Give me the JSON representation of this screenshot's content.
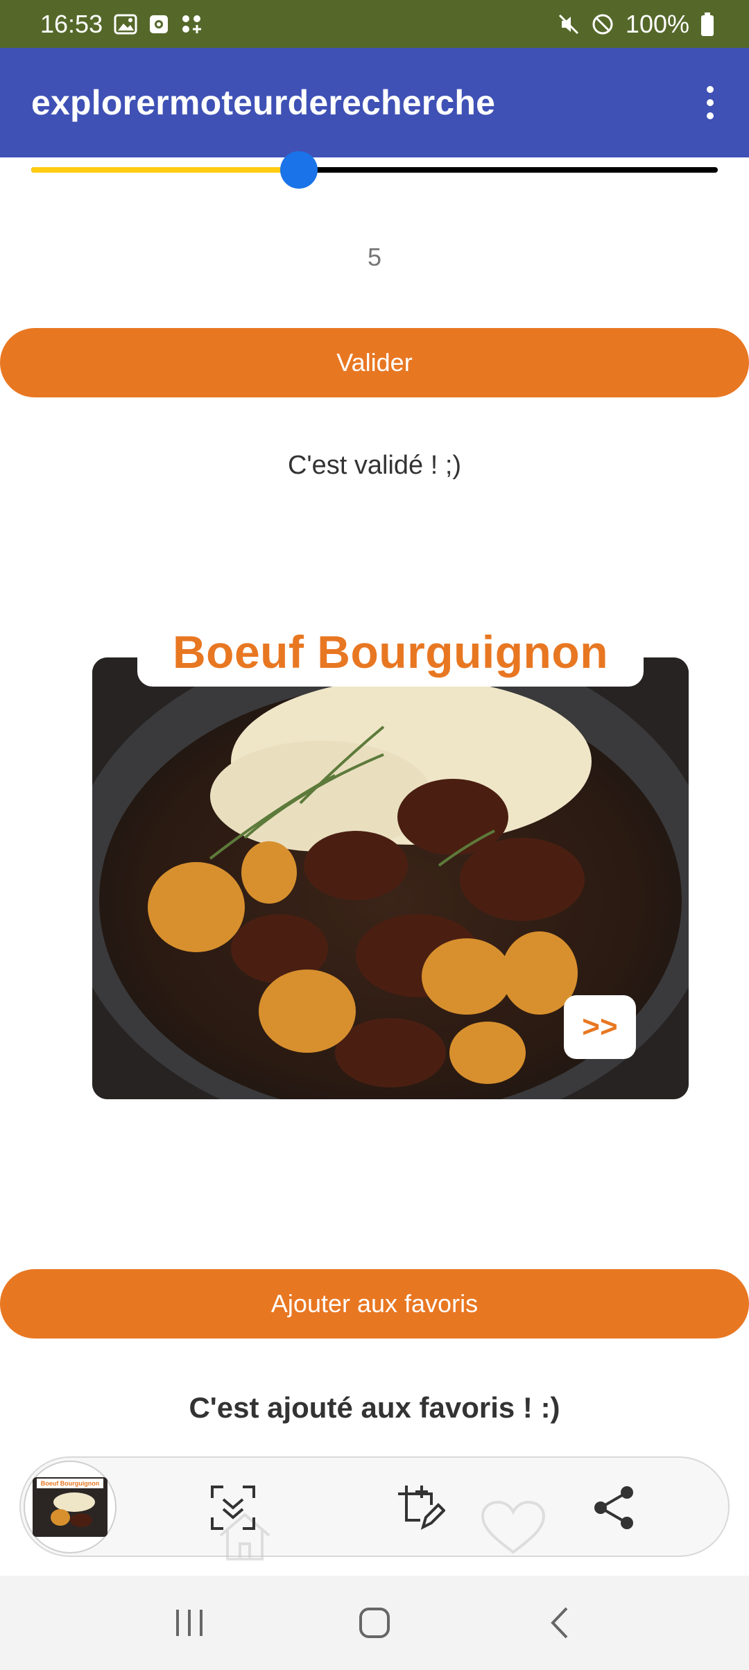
{
  "status_bar": {
    "time": "16:53",
    "battery": "100%",
    "icons": [
      "image-icon",
      "screen-record-icon",
      "dots-grid-icon",
      "mute-icon",
      "do-not-disturb-icon",
      "battery-icon"
    ]
  },
  "app_bar": {
    "title": "explorermoteurderecherche",
    "menu_icon": "more-vert-icon"
  },
  "slider": {
    "fraction": 0.39,
    "fill_color": "#ffcc12",
    "track_color": "#000000",
    "thumb_color": "#1a73e8"
  },
  "slider_value": "5",
  "validate_button": {
    "label": "Valider"
  },
  "validated_message": "C'est validé ! ;)",
  "recipe": {
    "title": "Boeuf Bourguignon",
    "next_label": ">>"
  },
  "favorites_button": {
    "label": "Ajouter aux favoris"
  },
  "favorites_message": "C'est ajouté aux favoris ! :)",
  "screenshot_toolbar": {
    "thumbnail_caption": "Boeuf Bourguignon",
    "actions": [
      "scan-icon",
      "crop-edit-icon",
      "share-icon"
    ]
  },
  "nav_bar": {
    "buttons": [
      "recent-apps-icon",
      "home-icon",
      "back-icon"
    ]
  },
  "colors": {
    "status_bar": "#55682a",
    "app_bar": "#3f51b5",
    "accent": "#e87722"
  }
}
